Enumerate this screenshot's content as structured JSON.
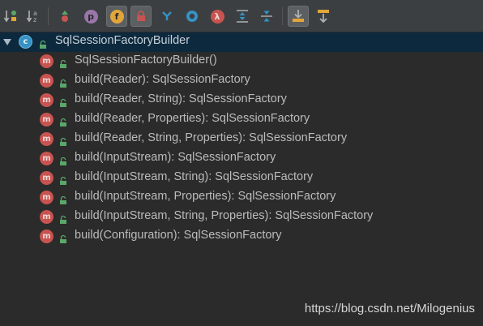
{
  "toolbar": {
    "buttons": [
      {
        "name": "sort-by-visibility",
        "icon": "sort-visibility-icon"
      },
      {
        "name": "sort-alphabetically",
        "icon": "sort-alpha-icon"
      },
      {
        "name": "show-inherited",
        "icon": "inherited-icon",
        "glyph": "↑"
      },
      {
        "name": "show-properties",
        "icon": "property-icon",
        "glyph": "p"
      },
      {
        "name": "show-fields",
        "icon": "field-icon",
        "glyph": "f"
      },
      {
        "name": "show-non-public",
        "icon": "lock-icon"
      },
      {
        "name": "show-anonymous",
        "icon": "anonymous-icon"
      },
      {
        "name": "show-interfaces",
        "icon": "interface-icon"
      },
      {
        "name": "show-lambdas",
        "icon": "lambda-icon",
        "glyph": "λ"
      },
      {
        "name": "expand-all",
        "icon": "expand-all-icon"
      },
      {
        "name": "collapse-all",
        "icon": "collapse-all-icon"
      },
      {
        "name": "autoscroll-to-source",
        "icon": "autoscroll-to-source-icon"
      },
      {
        "name": "autoscroll-from-source",
        "icon": "autoscroll-from-source-icon"
      }
    ]
  },
  "tree": {
    "class_icon_letter": "c",
    "method_icon_letter": "m",
    "root_label": "SqlSessionFactoryBuilder",
    "methods": [
      "SqlSessionFactoryBuilder()",
      "build(Reader): SqlSessionFactory",
      "build(Reader, String): SqlSessionFactory",
      "build(Reader, Properties): SqlSessionFactory",
      "build(Reader, String, Properties): SqlSessionFactory",
      "build(InputStream): SqlSessionFactory",
      "build(InputStream, String): SqlSessionFactory",
      "build(InputStream, Properties): SqlSessionFactory",
      "build(InputStream, String, Properties): SqlSessionFactory",
      "build(Configuration): SqlSessionFactory"
    ]
  },
  "watermark": "https://blog.csdn.net/Milogenius",
  "colors": {
    "background": "#2b2b2b",
    "toolbar": "#3c3f41",
    "selection": "#0d293e",
    "method_icon": "#c75450",
    "class_icon": "#3592c4",
    "lock_green": "#59a869",
    "text": "#bbbbbb"
  }
}
